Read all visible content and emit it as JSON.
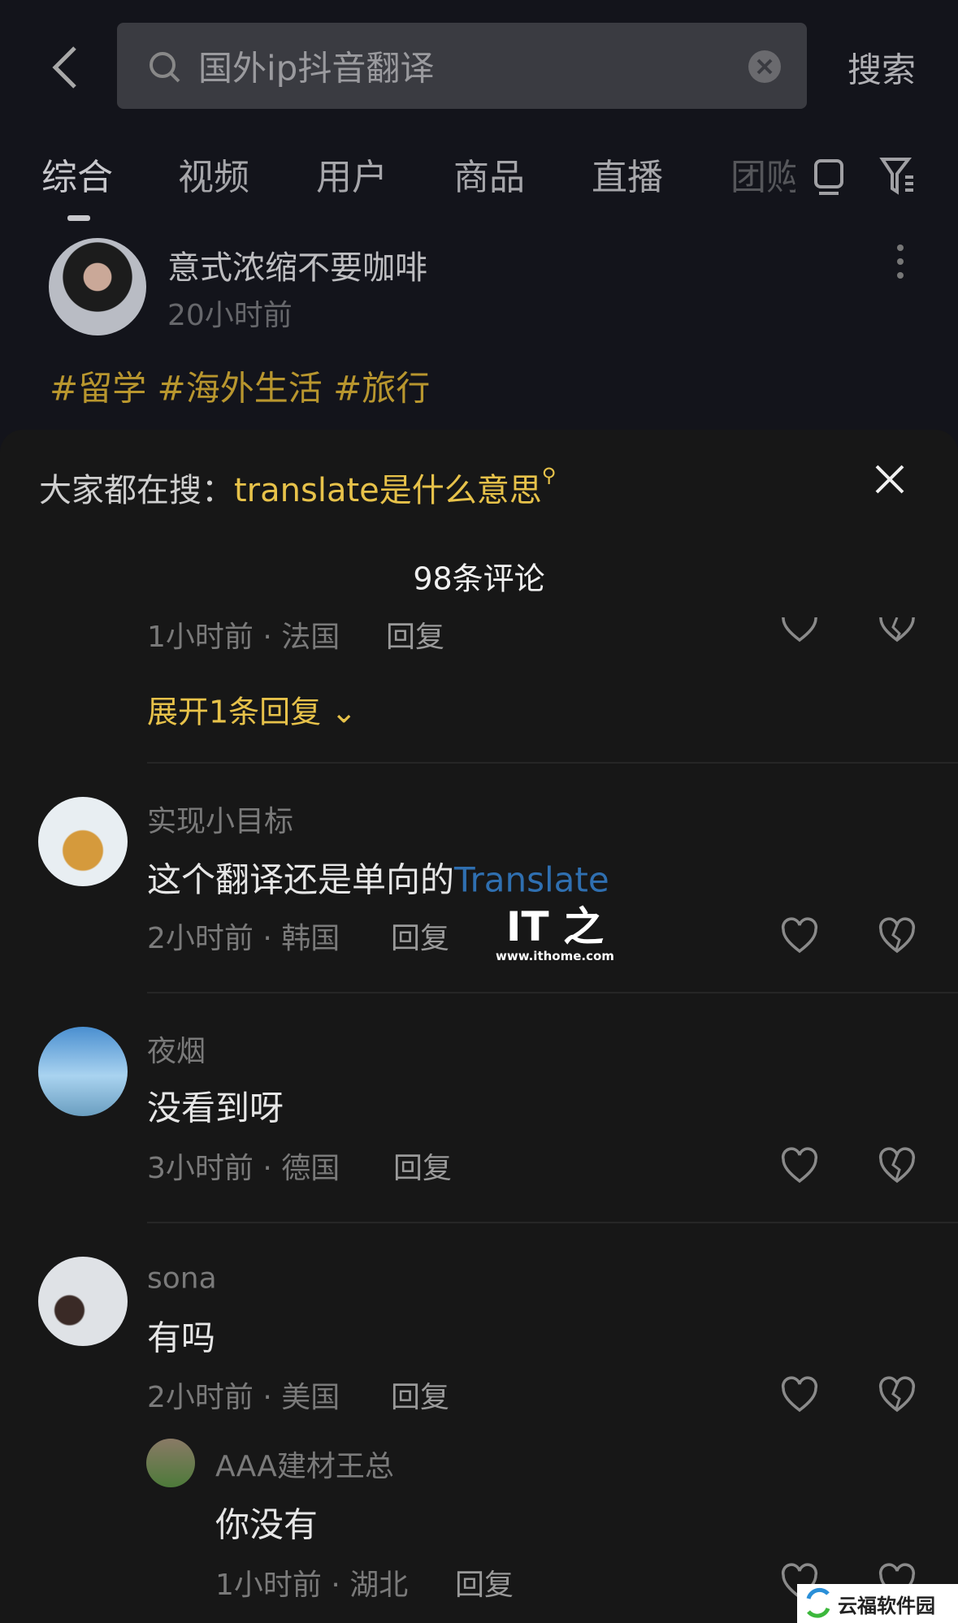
{
  "header": {
    "search_query": "国外ip抖音翻译",
    "search_button": "搜索"
  },
  "tabs": [
    "综合",
    "视频",
    "用户",
    "商品",
    "直播",
    "团购"
  ],
  "post": {
    "author": "意式浓缩不要咖啡",
    "time": "20小时前",
    "hashtags": "#留学 #海外生活 #旅行"
  },
  "sheet": {
    "suggest_prefix": "大家都在搜：",
    "suggest_query": "translate是什么意思",
    "comment_count": "98条评论",
    "partial": {
      "meta": "1小时前 · 法国",
      "reply": "回复",
      "expand": "展开1条回复"
    },
    "comments": [
      {
        "user": "实现小目标",
        "text": "这个翻译还是单向的",
        "link": "Translate",
        "meta": "2小时前 · 韩国",
        "reply": "回复"
      },
      {
        "user": "夜烟",
        "text": "没看到呀",
        "meta": "3小时前 · 德国",
        "reply": "回复"
      },
      {
        "user": "sona",
        "text": "有吗",
        "meta": "2小时前 · 美国",
        "reply": "回复"
      }
    ],
    "subreply": {
      "user": "AAA建材王总",
      "text": "你没有",
      "meta": "1小时前 · 湖北",
      "reply": "回复"
    }
  },
  "watermarks": {
    "ithome_logo": "IT之家",
    "ithome_url": "www.ithome.com",
    "yunfu": "云福软件园"
  },
  "colors": {
    "accent": "#e7c24a",
    "link": "#2f6fb0"
  }
}
